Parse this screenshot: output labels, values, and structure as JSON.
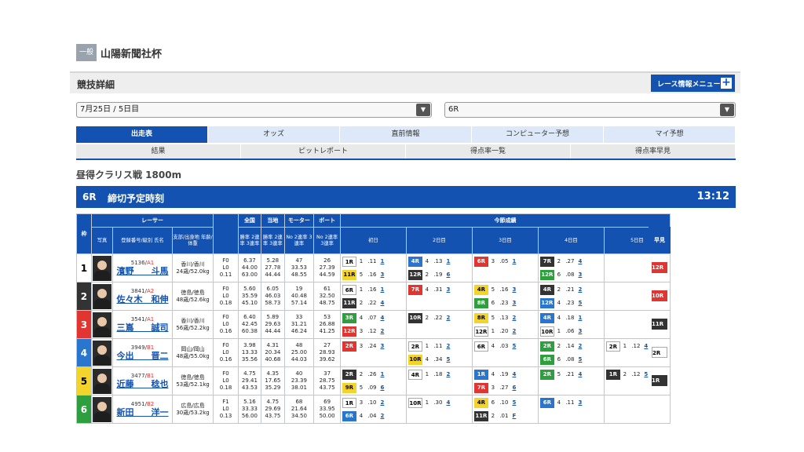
{
  "header": {
    "grade": "一般",
    "race_name": "山陽新聞社杯"
  },
  "section": {
    "title": "競技詳細",
    "menu_label": "レース情報メニュー",
    "menu_plus": "+"
  },
  "selects": {
    "date": "7月25日 / 5日目",
    "race": "6R",
    "arrow": "▼"
  },
  "tabs_main": [
    "出走表",
    "オッズ",
    "直前情報",
    "コンピューター予想",
    "マイ予想"
  ],
  "tabs_sub": [
    "結果",
    "ピットレポート",
    "得点率一覧",
    "得点率早見"
  ],
  "course": "昼得クラリス戦 1800m",
  "race_bar": {
    "no": "6R",
    "deadline_label": "締切予定時刻",
    "time": "13:12"
  },
  "table": {
    "h_frame": "枠",
    "h_racer": "レーサー",
    "h_national": "全国",
    "h_local": "当地",
    "h_motor": "モーター",
    "h_boat": "ボート",
    "h_sessions": "今節成績",
    "h_early": "早見",
    "h_photo": "写真",
    "h_reg": "登録番号/級別 氏名",
    "h_branch": "支部/出身地 年齢/体重",
    "h_f": "F数 L数 平均ST",
    "h_nat": "勝率 2連率 3連率",
    "h_loc": "勝率 2連率 3連率",
    "h_mot": "No 2連率 3連率",
    "h_boa": "No 2連率 3連率",
    "days": [
      "初日",
      "2日目",
      "3日目",
      "4日目",
      "5日目"
    ]
  },
  "racers": [
    {
      "frame": "1",
      "reg": "5136",
      "cls": "A1",
      "name": "濱野　　斗馬",
      "branch": "香川/香川",
      "age": "24歳/52.0kg",
      "f": "F0",
      "l": "L0",
      "st": "0.11",
      "nat": [
        "6.37",
        "44.00",
        "63.00"
      ],
      "loc": [
        "5.28",
        "27.78",
        "44.44"
      ],
      "mot": [
        "47",
        "33.53",
        "48.55"
      ],
      "boa": [
        "26",
        "27.39",
        "44.59"
      ],
      "early": "12R",
      "early_c": "c3",
      "days": [
        [
          [
            "1R",
            "c1",
            "1",
            ".11",
            "1"
          ],
          [
            "11R",
            "c5",
            "5",
            ".16",
            "3"
          ]
        ],
        [
          [
            "4R",
            "c4",
            "4",
            ".13",
            "1"
          ],
          [
            "12R",
            "c2",
            "2",
            ".19",
            "6"
          ]
        ],
        [
          [
            "6R",
            "c3",
            "3",
            ".05",
            "1"
          ]
        ],
        [
          [
            "7R",
            "c2",
            "2",
            ".27",
            "4"
          ],
          [
            "12R",
            "c6",
            "6",
            ".08",
            "3"
          ]
        ],
        []
      ]
    },
    {
      "frame": "2",
      "reg": "3841",
      "cls": "A2",
      "name": "佐々木　和伸",
      "branch": "徳島/徳島",
      "age": "48歳/52.6kg",
      "f": "F0",
      "l": "L0",
      "st": "0.18",
      "nat": [
        "5.60",
        "35.59",
        "45.10"
      ],
      "loc": [
        "6.05",
        "46.03",
        "58.73"
      ],
      "mot": [
        "19",
        "40.48",
        "57.14"
      ],
      "boa": [
        "61",
        "32.50",
        "48.75"
      ],
      "early": "10R",
      "early_c": "c3",
      "days": [
        [
          [
            "6R",
            "c1",
            "1",
            ".16",
            "1"
          ],
          [
            "11R",
            "c2",
            "2",
            ".22",
            "4"
          ]
        ],
        [
          [
            "7R",
            "c3",
            "4",
            ".31",
            "3"
          ]
        ],
        [
          [
            "4R",
            "c5",
            "5",
            ".16",
            "3"
          ],
          [
            "8R",
            "c6",
            "6",
            ".23",
            "3"
          ]
        ],
        [
          [
            "4R",
            "c2",
            "2",
            ".21",
            "2"
          ],
          [
            "12R",
            "c4",
            "4",
            ".23",
            "5"
          ]
        ],
        []
      ]
    },
    {
      "frame": "3",
      "reg": "3541",
      "cls": "A1",
      "name": "三嶌　　誠司",
      "branch": "香川/香川",
      "age": "56歳/52.2kg",
      "f": "F0",
      "l": "L0",
      "st": "0.16",
      "nat": [
        "6.40",
        "42.45",
        "60.38"
      ],
      "loc": [
        "5.89",
        "29.63",
        "44.44"
      ],
      "mot": [
        "33",
        "31.21",
        "46.24"
      ],
      "boa": [
        "53",
        "26.88",
        "41.25"
      ],
      "early": "11R",
      "early_c": "c2",
      "days": [
        [
          [
            "3R",
            "c6",
            "4",
            ".07",
            "4"
          ],
          [
            "12R",
            "c3",
            "3",
            ".12",
            "2"
          ]
        ],
        [
          [
            "10R",
            "c2",
            "2",
            ".22",
            "2"
          ]
        ],
        [
          [
            "8R",
            "c5",
            "5",
            ".13",
            "2"
          ],
          [
            "12R",
            "c1",
            "1",
            ".20",
            "2"
          ]
        ],
        [
          [
            "4R",
            "c4",
            "4",
            ".18",
            "1"
          ],
          [
            "10R",
            "c1",
            "1",
            ".06",
            "3"
          ]
        ],
        []
      ]
    },
    {
      "frame": "4",
      "reg": "3949",
      "cls": "B1",
      "name": "今出　　晋二",
      "branch": "岡山/岡山",
      "age": "48歳/55.0kg",
      "f": "F0",
      "l": "L0",
      "st": "0.16",
      "nat": [
        "3.98",
        "13.33",
        "35.56"
      ],
      "loc": [
        "4.31",
        "20.34",
        "40.68"
      ],
      "mot": [
        "48",
        "25.00",
        "44.03"
      ],
      "boa": [
        "27",
        "28.93",
        "39.62"
      ],
      "early": "2R",
      "early_c": "c1",
      "days": [
        [
          [
            "2R",
            "c3",
            "3",
            ".24",
            "3"
          ]
        ],
        [
          [
            "2R",
            "c1",
            "1",
            ".11",
            "2"
          ],
          [
            "10R",
            "c5",
            "4",
            ".34",
            "5"
          ]
        ],
        [
          [
            "6R",
            "c1",
            "4",
            ".03",
            "5"
          ]
        ],
        [
          [
            "2R",
            "c6",
            "2",
            ".14",
            "2"
          ],
          [
            "6R",
            "c6",
            "6",
            ".08",
            "5"
          ]
        ],
        [
          [
            "2R",
            "c1",
            "1",
            ".12",
            "4"
          ]
        ]
      ]
    },
    {
      "frame": "5",
      "reg": "3477",
      "cls": "B1",
      "name": "近藤　　稔也",
      "branch": "徳島/徳島",
      "age": "53歳/52.1kg",
      "f": "F0",
      "l": "L0",
      "st": "0.18",
      "nat": [
        "4.75",
        "29.41",
        "43.53"
      ],
      "loc": [
        "4.35",
        "17.65",
        "35.29"
      ],
      "mot": [
        "40",
        "23.39",
        "38.01"
      ],
      "boa": [
        "37",
        "28.75",
        "43.75"
      ],
      "early": "1R",
      "early_c": "c2",
      "days": [
        [
          [
            "2R",
            "c2",
            "2",
            ".26",
            "1"
          ],
          [
            "9R",
            "c5",
            "5",
            ".09",
            "6"
          ]
        ],
        [
          [
            "4R",
            "c1",
            "1",
            ".18",
            "2"
          ]
        ],
        [
          [
            "1R",
            "c4",
            "4",
            ".19",
            "4"
          ],
          [
            "7R",
            "c3",
            "3",
            ".27",
            "6"
          ]
        ],
        [
          [
            "2R",
            "c6",
            "5",
            ".21",
            "4"
          ]
        ],
        [
          [
            "1R",
            "c2",
            "2",
            ".12",
            "5"
          ]
        ]
      ]
    },
    {
      "frame": "6",
      "reg": "4951",
      "cls": "B2",
      "name": "新田　　洋一",
      "branch": "広島/広島",
      "age": "30歳/53.2kg",
      "f": "F1",
      "l": "L0",
      "st": "0.13",
      "nat": [
        "5.16",
        "33.33",
        "56.00"
      ],
      "loc": [
        "4.75",
        "29.69",
        "43.75"
      ],
      "mot": [
        "68",
        "21.64",
        "34.50"
      ],
      "boa": [
        "69",
        "33.95",
        "50.00"
      ],
      "early": "",
      "early_c": "",
      "days": [
        [
          [
            "1R",
            "c1",
            "3",
            ".10",
            "2"
          ],
          [
            "6R",
            "c4",
            "4",
            ".04",
            "2"
          ]
        ],
        [
          [
            "10R",
            "c1",
            "1",
            ".30",
            "4"
          ]
        ],
        [
          [
            "4R",
            "c5",
            "6",
            ".10",
            "5"
          ],
          [
            "11R",
            "c2",
            "2",
            ".01",
            "F"
          ]
        ],
        [
          [
            "6R",
            "c4",
            "4",
            ".11",
            "3"
          ]
        ],
        []
      ]
    }
  ]
}
